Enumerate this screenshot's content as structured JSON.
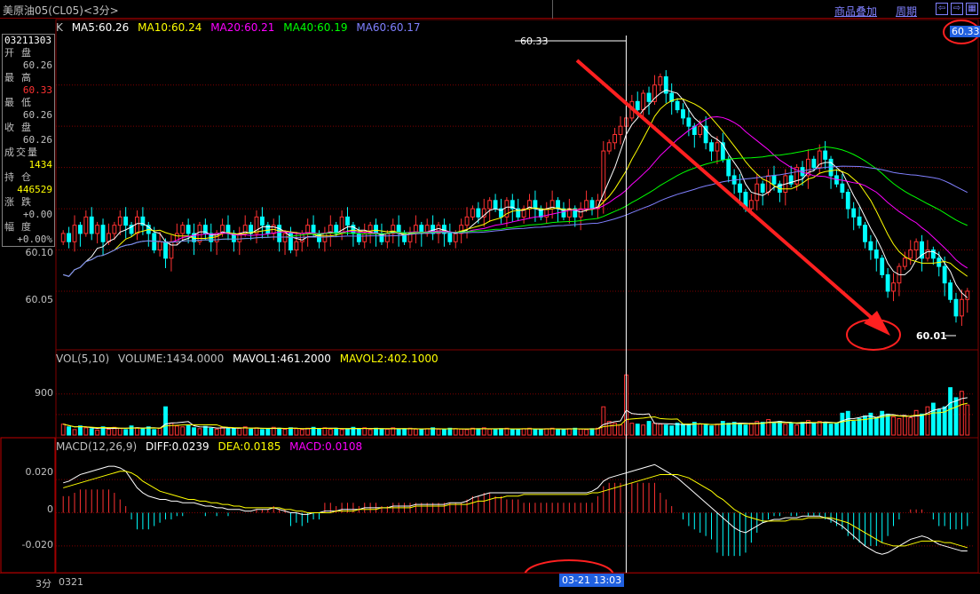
{
  "header": {
    "title": "美原油05(CL05)<3分>",
    "overlay_link": "商品叠加",
    "period_link": "周期"
  },
  "main_indicator": {
    "prefix": "K",
    "ma5": "MA5:60.26",
    "ma10": "MA10:60.24",
    "ma20": "MA20:60.21",
    "ma40": "MA40:60.19",
    "ma60": "MA60:60.17"
  },
  "vol_indicator": {
    "name": "VOL(5,10)",
    "volume": "VOLUME:1434.0000",
    "mavol1": "MAVOL1:461.2000",
    "mavol2": "MAVOL2:402.1000"
  },
  "macd_indicator": {
    "name": "MACD(12,26,9)",
    "diff": "DIFF:0.0239",
    "dea": "DEA:0.0185",
    "macd": "MACD:0.0108"
  },
  "info_box": {
    "date": "03211303",
    "open_label": "开盘",
    "open": "60.26",
    "high_label": "最高",
    "high": "60.33",
    "low_label": "最低",
    "low": "60.26",
    "close_label": "收盘",
    "close": "60.26",
    "volume_label": "成交量",
    "volume": "1434",
    "oi_label": "持仓",
    "oi": "446529",
    "change_label": "涨跌",
    "change": "+0.00",
    "pct_label": "幅度",
    "pct": "+0.00%"
  },
  "axis": {
    "price_ticks": [
      "60.10",
      "60.05"
    ],
    "vol_ticks": [
      "900"
    ],
    "macd_ticks": [
      "0.020",
      "0",
      "-0.020"
    ]
  },
  "annotations": {
    "high_mark": "60.33",
    "low_mark": "60.01",
    "right_price": "60.33",
    "crosshair_time": "03-21 13:03"
  },
  "footer": {
    "period": "3分",
    "date": "0321"
  },
  "colors": {
    "up": "#ff3232",
    "down": "#00ffff",
    "ma5": "#ffffff",
    "ma10": "#ffff00",
    "ma20": "#ff00ff",
    "ma40": "#00ff00",
    "ma60": "#8080ff",
    "grid": "#800000",
    "annotation": "#ff2020"
  },
  "chart_data": {
    "type": "candlestick",
    "price_ylim": [
      59.98,
      60.36
    ],
    "vol_ylim": [
      0,
      1500
    ],
    "macd_ylim": [
      -0.035,
      0.035
    ],
    "crosshair_index": 99,
    "close": [
      60.12,
      60.11,
      60.13,
      60.12,
      60.14,
      60.12,
      60.13,
      60.11,
      60.12,
      60.13,
      60.14,
      60.13,
      60.12,
      60.14,
      60.13,
      60.12,
      60.1,
      60.11,
      60.09,
      60.11,
      60.12,
      60.13,
      60.12,
      60.11,
      60.13,
      60.12,
      60.11,
      60.12,
      60.13,
      60.12,
      60.11,
      60.12,
      60.13,
      60.12,
      60.14,
      60.13,
      60.12,
      60.13,
      60.11,
      60.12,
      60.1,
      60.11,
      60.12,
      60.13,
      60.12,
      60.11,
      60.12,
      60.13,
      60.12,
      60.14,
      60.13,
      60.12,
      60.11,
      60.12,
      60.13,
      60.12,
      60.11,
      60.12,
      60.13,
      60.12,
      60.11,
      60.12,
      60.13,
      60.12,
      60.13,
      60.12,
      60.13,
      60.12,
      60.11,
      60.12,
      60.13,
      60.14,
      60.15,
      60.14,
      60.15,
      60.16,
      60.15,
      60.14,
      60.16,
      60.15,
      60.14,
      60.15,
      60.16,
      60.15,
      60.14,
      60.15,
      60.16,
      60.15,
      60.14,
      60.15,
      60.14,
      60.15,
      60.16,
      60.15,
      60.16,
      60.22,
      60.23,
      60.24,
      60.25,
      60.26,
      60.28,
      60.27,
      60.29,
      60.28,
      60.3,
      60.31,
      60.29,
      60.28,
      60.27,
      60.26,
      60.25,
      60.24,
      60.25,
      60.23,
      60.22,
      60.23,
      60.21,
      60.19,
      60.18,
      60.17,
      60.15,
      60.16,
      60.18,
      60.17,
      60.19,
      60.18,
      60.17,
      60.19,
      60.18,
      60.2,
      60.19,
      60.21,
      60.2,
      60.22,
      60.21,
      60.19,
      60.18,
      60.17,
      60.15,
      60.14,
      60.13,
      60.11,
      60.1,
      60.09,
      60.07,
      60.05,
      60.06,
      60.08,
      60.09,
      60.1,
      60.11,
      60.09,
      60.1,
      60.09,
      60.08,
      60.06,
      60.04,
      60.02,
      60.04,
      60.05
    ],
    "volume": [
      240,
      180,
      120,
      200,
      160,
      140,
      110,
      180,
      130,
      170,
      150,
      120,
      200,
      160,
      140,
      180,
      120,
      150,
      620,
      260,
      200,
      180,
      220,
      160,
      140,
      190,
      150,
      130,
      170,
      160,
      140,
      150,
      180,
      130,
      160,
      120,
      140,
      170,
      150,
      130,
      160,
      140,
      120,
      150,
      170,
      140,
      160,
      130,
      150,
      120,
      140,
      170,
      130,
      160,
      120,
      150,
      140,
      130,
      160,
      120,
      140,
      150,
      130,
      120,
      140,
      160,
      130,
      120,
      150,
      140,
      130,
      120,
      150,
      140,
      160,
      130,
      120,
      140,
      150,
      130,
      120,
      140,
      150,
      130,
      120,
      140,
      150,
      130,
      120,
      140,
      150,
      130,
      120,
      140,
      150,
      620,
      300,
      260,
      220,
      1320,
      260,
      240,
      220,
      300,
      260,
      240,
      220,
      200,
      260,
      240,
      220,
      280,
      240,
      220,
      200,
      240,
      300,
      260,
      280,
      240,
      220,
      260,
      300,
      280,
      340,
      260,
      300,
      240,
      260,
      220,
      280,
      320,
      260,
      300,
      280,
      240,
      260,
      480,
      520,
      300,
      360,
      420,
      480,
      380,
      520,
      460,
      400,
      360,
      420,
      380,
      540,
      460,
      620,
      700,
      560,
      620,
      1040,
      820,
      960,
      660
    ],
    "macd_diff": [
      0.018,
      0.019,
      0.021,
      0.023,
      0.024,
      0.025,
      0.026,
      0.027,
      0.028,
      0.028,
      0.027,
      0.025,
      0.02,
      0.015,
      0.012,
      0.01,
      0.009,
      0.008,
      0.008,
      0.007,
      0.007,
      0.006,
      0.006,
      0.006,
      0.005,
      0.004,
      0.004,
      0.003,
      0.003,
      0.002,
      0.002,
      0.002,
      0.001,
      0.001,
      0.002,
      0.002,
      0.002,
      0.003,
      0.002,
      0.001,
      0.0,
      0.0,
      -0.001,
      -0.001,
      0.0,
      0.0,
      0.001,
      0.001,
      0.001,
      0.002,
      0.002,
      0.002,
      0.002,
      0.003,
      0.003,
      0.003,
      0.003,
      0.003,
      0.004,
      0.004,
      0.004,
      0.004,
      0.005,
      0.005,
      0.005,
      0.005,
      0.005,
      0.005,
      0.006,
      0.006,
      0.006,
      0.007,
      0.009,
      0.01,
      0.011,
      0.012,
      0.012,
      0.012,
      0.012,
      0.012,
      0.012,
      0.012,
      0.012,
      0.012,
      0.012,
      0.012,
      0.012,
      0.012,
      0.012,
      0.012,
      0.012,
      0.012,
      0.012,
      0.013,
      0.015,
      0.019,
      0.021,
      0.022,
      0.023,
      0.024,
      0.025,
      0.026,
      0.027,
      0.028,
      0.029,
      0.027,
      0.025,
      0.023,
      0.021,
      0.018,
      0.015,
      0.012,
      0.009,
      0.006,
      0.003,
      0.0,
      -0.003,
      -0.006,
      -0.009,
      -0.011,
      -0.012,
      -0.01,
      -0.008,
      -0.006,
      -0.005,
      -0.004,
      -0.004,
      -0.003,
      -0.003,
      -0.003,
      -0.002,
      -0.002,
      -0.002,
      -0.002,
      -0.003,
      -0.004,
      -0.006,
      -0.008,
      -0.011,
      -0.014,
      -0.017,
      -0.02,
      -0.022,
      -0.024,
      -0.025,
      -0.024,
      -0.022,
      -0.02,
      -0.018,
      -0.016,
      -0.015,
      -0.014,
      -0.015,
      -0.017,
      -0.019,
      -0.02,
      -0.021,
      -0.022,
      -0.023,
      -0.023
    ],
    "macd_dea": [
      0.015,
      0.016,
      0.017,
      0.018,
      0.019,
      0.02,
      0.021,
      0.022,
      0.023,
      0.024,
      0.025,
      0.025,
      0.024,
      0.022,
      0.019,
      0.017,
      0.015,
      0.013,
      0.012,
      0.011,
      0.01,
      0.009,
      0.008,
      0.008,
      0.007,
      0.007,
      0.006,
      0.006,
      0.005,
      0.005,
      0.004,
      0.004,
      0.003,
      0.003,
      0.003,
      0.003,
      0.003,
      0.003,
      0.003,
      0.002,
      0.002,
      0.001,
      0.001,
      0.0,
      0.0,
      0.0,
      0.0,
      0.0,
      0.001,
      0.001,
      0.001,
      0.001,
      0.002,
      0.002,
      0.002,
      0.002,
      0.003,
      0.003,
      0.003,
      0.003,
      0.003,
      0.003,
      0.004,
      0.004,
      0.004,
      0.004,
      0.004,
      0.004,
      0.005,
      0.005,
      0.005,
      0.005,
      0.006,
      0.007,
      0.007,
      0.008,
      0.009,
      0.009,
      0.01,
      0.01,
      0.01,
      0.011,
      0.011,
      0.011,
      0.011,
      0.011,
      0.011,
      0.011,
      0.011,
      0.011,
      0.011,
      0.011,
      0.011,
      0.012,
      0.012,
      0.013,
      0.014,
      0.015,
      0.016,
      0.017,
      0.018,
      0.019,
      0.02,
      0.021,
      0.022,
      0.023,
      0.023,
      0.023,
      0.023,
      0.022,
      0.021,
      0.019,
      0.017,
      0.015,
      0.013,
      0.01,
      0.008,
      0.005,
      0.002,
      0.0,
      -0.002,
      -0.003,
      -0.004,
      -0.005,
      -0.005,
      -0.005,
      -0.005,
      -0.005,
      -0.004,
      -0.004,
      -0.004,
      -0.003,
      -0.003,
      -0.003,
      -0.003,
      -0.003,
      -0.004,
      -0.005,
      -0.006,
      -0.008,
      -0.01,
      -0.012,
      -0.014,
      -0.016,
      -0.018,
      -0.019,
      -0.02,
      -0.02,
      -0.02,
      -0.019,
      -0.018,
      -0.017,
      -0.017,
      -0.017,
      -0.017,
      -0.018,
      -0.018,
      -0.019,
      -0.02,
      -0.021
    ]
  }
}
